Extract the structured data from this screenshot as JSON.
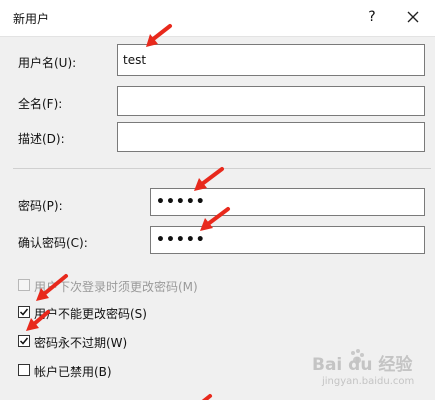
{
  "dialog": {
    "title": "新用户",
    "help_label": "?"
  },
  "fields": {
    "username": {
      "label": "用户名(U):",
      "value": "test"
    },
    "fullname": {
      "label": "全名(F):",
      "value": ""
    },
    "description": {
      "label": "描述(D):",
      "value": ""
    },
    "password": {
      "label": "密码(P):",
      "value": "•••••"
    },
    "confirm_password": {
      "label": "确认密码(C):",
      "value": "•••••"
    }
  },
  "options": [
    {
      "label": "用户下次登录时须更改密码(M)",
      "checked": false,
      "enabled": false
    },
    {
      "label": "用户不能更改密码(S)",
      "checked": true,
      "enabled": true
    },
    {
      "label": "密码永不过期(W)",
      "checked": true,
      "enabled": true
    },
    {
      "label": "帐户已禁用(B)",
      "checked": false,
      "enabled": true
    }
  ],
  "watermark": {
    "text": "Bai du 经验",
    "url": "jingyan.baidu.com"
  },
  "colors": {
    "annotation_arrow": "#e8291c",
    "title_bar": "#ffffff",
    "window_bg": "#f0f0f0"
  }
}
